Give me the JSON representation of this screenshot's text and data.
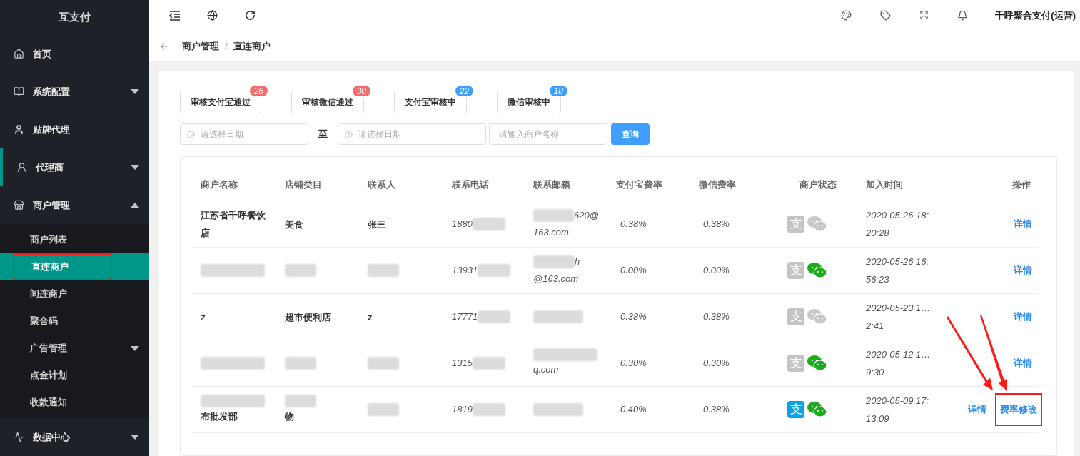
{
  "sidebar": {
    "brand": "互支付",
    "items": [
      {
        "label": "首页",
        "has_caret": false,
        "indicator": false
      },
      {
        "label": "系统配置",
        "has_caret": true,
        "expanded": false,
        "indicator": false
      },
      {
        "label": "贴牌代理",
        "has_caret": false,
        "indicator": false
      },
      {
        "label": "代理商",
        "has_caret": true,
        "expanded": false,
        "indicator": true
      },
      {
        "label": "商户管理",
        "has_caret": true,
        "expanded": true,
        "indicator": false,
        "children": [
          {
            "label": "商户列表",
            "selected": false,
            "annotated": false,
            "has_caret": false
          },
          {
            "label": "直连商户",
            "selected": true,
            "annotated": true,
            "has_caret": false
          },
          {
            "label": "间连商户",
            "selected": false,
            "annotated": false,
            "has_caret": false
          },
          {
            "label": "聚合码",
            "selected": false,
            "annotated": false,
            "has_caret": false
          },
          {
            "label": "广告管理",
            "selected": false,
            "annotated": false,
            "has_caret": true
          },
          {
            "label": "点金计划",
            "selected": false,
            "annotated": false,
            "has_caret": false
          },
          {
            "label": "收款通知",
            "selected": false,
            "annotated": false,
            "has_caret": false
          }
        ]
      },
      {
        "label": "数据中心",
        "has_caret": true,
        "expanded": false,
        "indicator": false
      }
    ]
  },
  "header": {
    "user": "千呼聚合支付(运营)"
  },
  "breadcrumb": [
    "商户管理",
    "直连商户"
  ],
  "breadcrumb_separator": "/",
  "filter_tabs": [
    {
      "label": "审核支付宝通过",
      "count": "26",
      "color": "#f56c6c"
    },
    {
      "label": "审核微信通过",
      "count": "30",
      "color": "#f56c6c"
    },
    {
      "label": "支付宝审核中",
      "count": "22",
      "color": "#409eff"
    },
    {
      "label": "微信审核中",
      "count": "18",
      "color": "#409eff"
    }
  ],
  "search": {
    "start_date": {
      "placeholder": "请选择日期"
    },
    "separator": "至",
    "end_date": {
      "placeholder": "请选择日期"
    },
    "name": {
      "placeholder": "请输入商户名称"
    },
    "button": "查询"
  },
  "table": {
    "columns": [
      "商户名称",
      "店铺类目",
      "联系人",
      "联系电话",
      "联系邮箱",
      "支付宝费率",
      "微信费率",
      "商户状态",
      "加入时间",
      "操作"
    ],
    "rows": [
      {
        "name": {
          "text": "江苏省千呼餐饮店",
          "blurred": false
        },
        "category": {
          "text": "美食",
          "blurred": false
        },
        "contact": {
          "text": "张三",
          "blurred": false
        },
        "phone": {
          "text": "1880",
          "blurred": true
        },
        "email": {
          "lines": [
            "620@",
            "163.com"
          ],
          "blurred": true
        },
        "alipay_rate": "0.38%",
        "wechat_rate": "0.38%",
        "alipay": {
          "glyph": "支",
          "on": false
        },
        "wechat_on": false,
        "joined": [
          "2020-05-26 18:",
          "20:28"
        ],
        "actions": [
          {
            "label": "详情",
            "annotated": false
          }
        ]
      },
      {
        "name": {
          "blurred": true
        },
        "category": {
          "blurred": true
        },
        "contact": {
          "blurred": true
        },
        "phone": {
          "text": "13931",
          "blurred": true
        },
        "email": {
          "lines": [
            "h",
            "@163.com"
          ],
          "blurred": true
        },
        "alipay_rate": "0.00%",
        "wechat_rate": "0.00%",
        "alipay": {
          "glyph": "支",
          "on": false
        },
        "wechat_on": true,
        "joined": [
          "2020-05-26 16:",
          "56:23"
        ],
        "actions": [
          {
            "label": "详情",
            "annotated": false
          }
        ]
      },
      {
        "name": {
          "text": "z",
          "blurred": false
        },
        "category": {
          "text": "超市便利店",
          "blurred": false
        },
        "contact": {
          "text": "z",
          "blurred": false
        },
        "phone": {
          "text": "17771",
          "blurred": true
        },
        "email": {
          "blurred": true
        },
        "alipay_rate": "0.38%",
        "wechat_rate": "0.38%",
        "alipay": {
          "glyph": "支",
          "on": false
        },
        "wechat_on": false,
        "joined": [
          "2020-05-23 1…",
          "2:41"
        ],
        "actions": [
          {
            "label": "详情",
            "annotated": false
          }
        ]
      },
      {
        "name": {
          "blurred": true
        },
        "category": {
          "blurred": true
        },
        "contact": {
          "blurred": true
        },
        "phone": {
          "text": "1315",
          "blurred": true
        },
        "email": {
          "lines": [
            "q.com"
          ],
          "blurred": true
        },
        "alipay_rate": "0.30%",
        "wechat_rate": "0.30%",
        "alipay": {
          "glyph": "支",
          "on": false
        },
        "wechat_on": true,
        "joined": [
          "2020-05-12 1…",
          "9:30"
        ],
        "actions": [
          {
            "label": "详情",
            "annotated": false
          }
        ]
      },
      {
        "name": {
          "text": "布批发部",
          "blurred": true
        },
        "category": {
          "text": "物",
          "blurred": true
        },
        "contact": {
          "blurred": true
        },
        "phone": {
          "text": "1819",
          "blurred": true
        },
        "email": {
          "blurred": true
        },
        "alipay_rate": "0.40%",
        "wechat_rate": "0.38%",
        "alipay": {
          "glyph": "支",
          "on": true
        },
        "wechat_on": true,
        "joined": [
          "2020-05-09 17:",
          "13:09"
        ],
        "actions": [
          {
            "label": "详情",
            "annotated": false
          },
          {
            "label": "费率修改",
            "annotated": true
          }
        ]
      }
    ]
  }
}
